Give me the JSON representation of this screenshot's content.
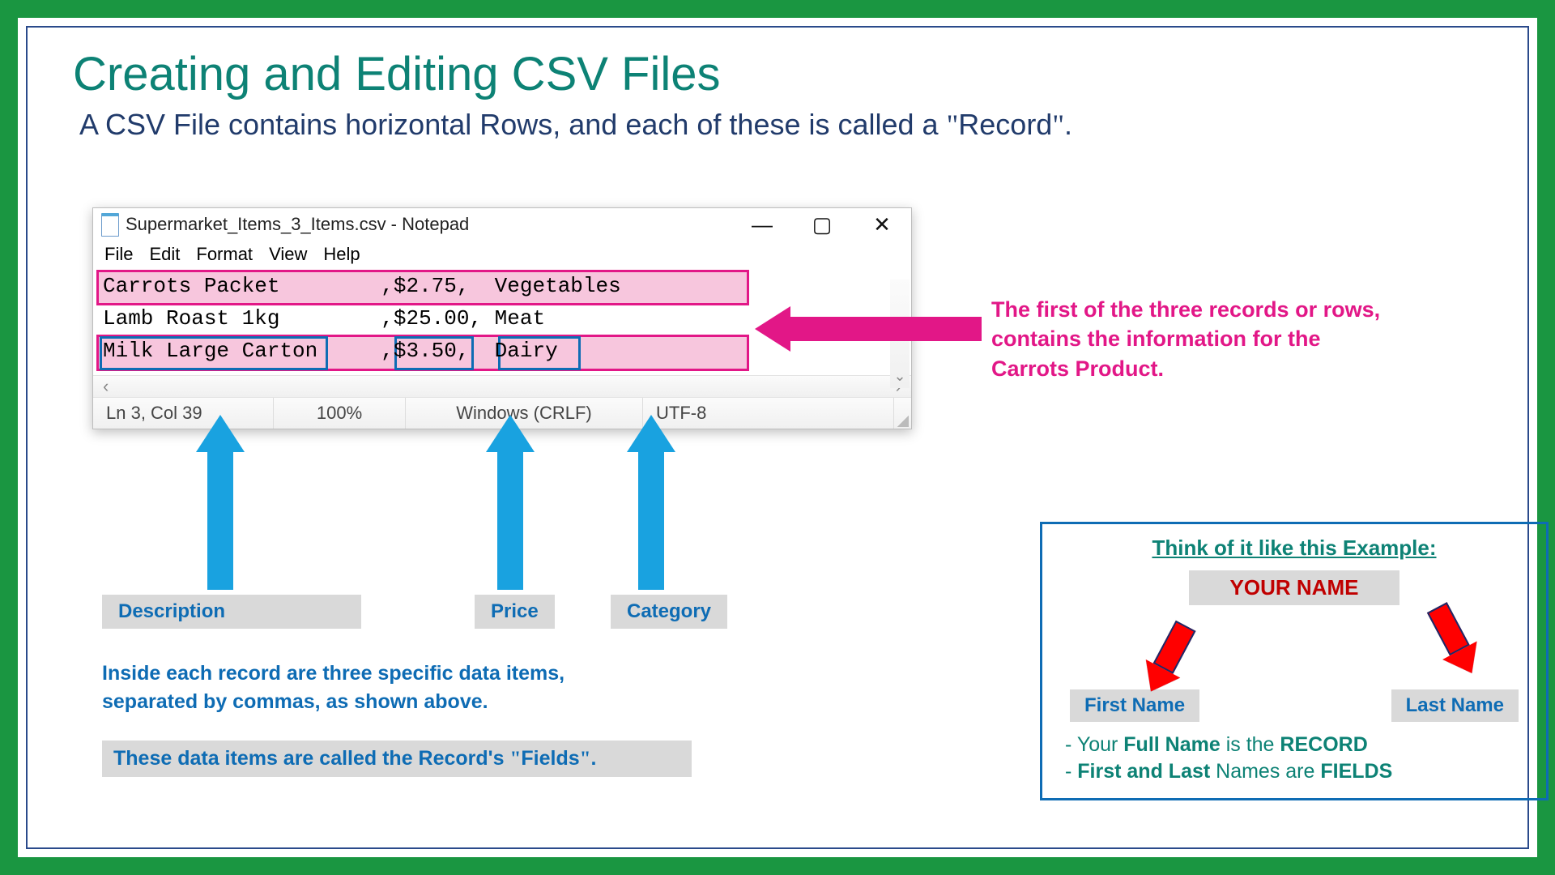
{
  "slide": {
    "title": "Creating and Editing CSV Files",
    "subtitle_pre": "A CSV File contains horizontal Rows, and each of these is called a ",
    "subtitle_q1": "\"",
    "subtitle_word": "Record",
    "subtitle_q2": "\"",
    "subtitle_post": "."
  },
  "notepad": {
    "title": "Supermarket_Items_3_Items.csv - Notepad",
    "menu": [
      "File",
      "Edit",
      "Format",
      "View",
      "Help"
    ],
    "lines": [
      "Carrots Packet        ,$2.75,  Vegetables",
      "Lamb Roast 1kg        ,$25.00, Meat",
      "Milk Large Carton     ,$3.50,  Dairy"
    ],
    "status": {
      "pos": "Ln 3, Col 39",
      "zoom": "100%",
      "eol": "Windows (CRLF)",
      "enc": "UTF-8"
    },
    "sys": {
      "min": "—",
      "max": "▢",
      "close": "✕"
    },
    "scroll": {
      "left": "‹",
      "right": "›",
      "down": "⌄"
    }
  },
  "labels": {
    "description": "Description",
    "price": "Price",
    "category": "Category"
  },
  "body": {
    "line1": "Inside each record are three specific data items,",
    "line2": "separated by commas, as shown above.",
    "fields_note_pre": "These data items are called the Record's ",
    "fields_note_q1": "\"",
    "fields_note_word": "Fields",
    "fields_note_q2": "\"",
    "fields_note_post": "."
  },
  "callout": {
    "line1": "The first of the three records or rows,",
    "line2": "contains the information for the",
    "line3": "Carrots Product."
  },
  "example": {
    "title": "Think of it like this Example:",
    "your_name": "YOUR NAME",
    "first": "First Name",
    "last": "Last Name",
    "l1a": "- Your ",
    "l1b": "Full Name",
    "l1c": " is the ",
    "l1d": "RECORD",
    "l2a": "- ",
    "l2b": "First and Last",
    "l2c": " Names are ",
    "l2d": "FIELDS"
  }
}
